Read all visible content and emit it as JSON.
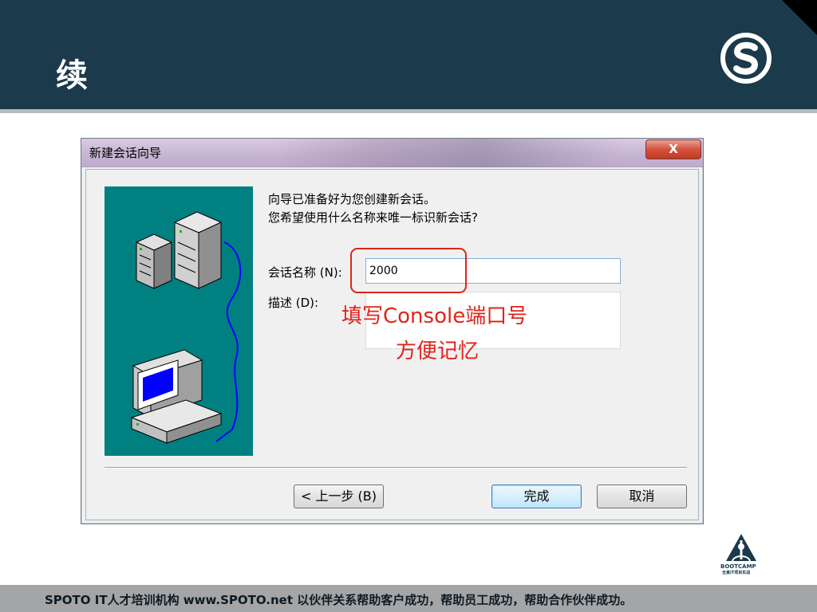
{
  "slide": {
    "title": "续",
    "footer": "SPOTO IT人才培训机构    www.SPOTO.net    以伙伴关系帮助客户成功，帮助员工成功，帮助合作伙伴成功。",
    "bootcamp_word": "BOOTCAMP",
    "bootcamp_sub": "全真IT项目实战"
  },
  "dialog": {
    "title": "新建会话向导",
    "close_label": "X",
    "prompt_line1": "向导已准备好为您创建新会话。",
    "prompt_line2": "您希望使用什么名称来唯一标识新会话?",
    "name_label": "会话名称 (N):",
    "name_value": "2000",
    "desc_label": "描述 (D):",
    "back_label": "< 上一步 (B)",
    "finish_label": "完成",
    "cancel_label": "取消"
  },
  "annotation": {
    "line1": "填写Console端口号",
    "line2": "方便记忆"
  },
  "colors": {
    "header": "#1b3a4b",
    "annotation": "#e0241b",
    "illustration_bg": "#008080"
  }
}
